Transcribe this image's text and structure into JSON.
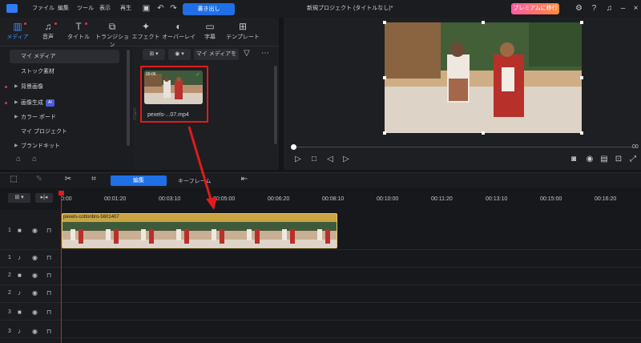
{
  "menu": [
    "ファイル",
    "編集",
    "ツール",
    "表示",
    "再生"
  ],
  "toolbar": {
    "export_label": "書き出し",
    "project_title": "新規プロジェクト (タイトルなし)*",
    "premium_label": "プレミアムに移行"
  },
  "media_tabs": [
    {
      "label": "メディア",
      "icon": "media-icon"
    },
    {
      "label": "音声",
      "icon": "music-icon"
    },
    {
      "label": "タイトル",
      "icon": "title-icon"
    },
    {
      "label": "トランジション",
      "icon": "transition-icon"
    },
    {
      "label": "エフェクト",
      "icon": "effect-icon"
    },
    {
      "label": "オーバーレイ",
      "icon": "overlay-icon"
    },
    {
      "label": "字幕",
      "icon": "subtitle-icon"
    },
    {
      "label": "テンプレート",
      "icon": "template-icon"
    }
  ],
  "sidebar": {
    "items": [
      {
        "label": "マイ メディア"
      },
      {
        "label": "ストック素材"
      },
      {
        "label": "背景画像"
      },
      {
        "label": "画像生成",
        "badge": "AI"
      },
      {
        "label": "カラー ボード"
      },
      {
        "label": "マイ プロジェクト"
      },
      {
        "label": "ブランドキット"
      }
    ]
  },
  "content": {
    "filter_label": "マイ メディアを",
    "clip_name": "pexels-...07.mp4",
    "thumb_duration": "00:06"
  },
  "player": {
    "time": "00"
  },
  "timeline": {
    "edit_tab": "編集",
    "keyframe_tab": "キーフレーム",
    "ticks": [
      "0:00",
      "00:01:20",
      "00:03:10",
      "00:05:00",
      "00:06:20",
      "00:08:10",
      "00:10:00",
      "00:11:20",
      "00:13:10",
      "00:15:00",
      "00:16:20"
    ],
    "clip_label": "pexels-cottonbro-5601407",
    "tracks": [
      "1",
      "1",
      "2",
      "2",
      "3",
      "3"
    ]
  },
  "colors": {
    "accent": "#1f6fe6",
    "highlight": "#e01b1b",
    "clip": "#c9a442"
  }
}
